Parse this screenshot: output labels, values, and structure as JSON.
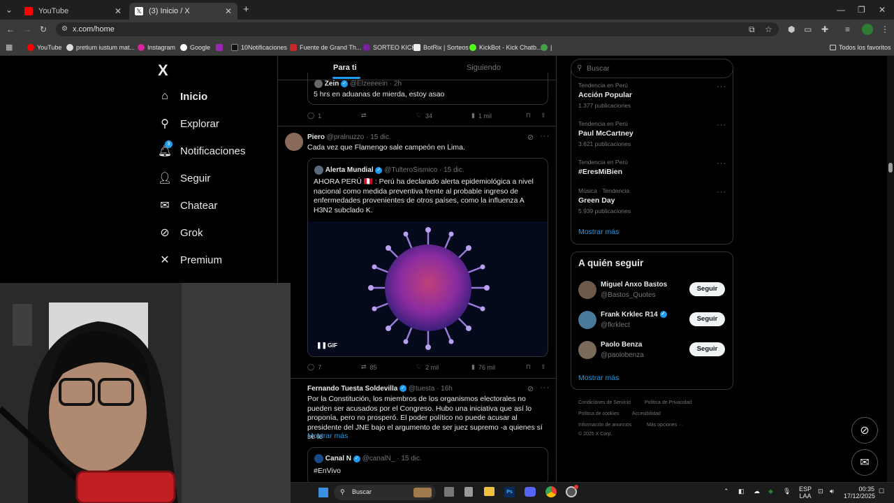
{
  "browser": {
    "tabs": [
      {
        "title": "YouTube",
        "active": false
      },
      {
        "title": "(3) Inicio / X",
        "active": true
      }
    ],
    "url": "x.com/home",
    "bookmarks": [
      "YouTube",
      "pretium iustum mat...",
      "Instagram",
      "Google",
      "10Notificaciones",
      "Fuente de Grand Th...",
      "SORTEO KICK",
      "BotRix | Sorteos",
      "KickBot - Kick Chatb..."
    ],
    "all_bookmarks": "Todos los favoritos"
  },
  "nav": {
    "logo": "X",
    "items": [
      {
        "label": "Inicio",
        "icon": "home-icon"
      },
      {
        "label": "Explorar",
        "icon": "search-icon"
      },
      {
        "label": "Notificaciones",
        "icon": "bell-icon",
        "badge": "3"
      },
      {
        "label": "Seguir",
        "icon": "person-plus-icon"
      },
      {
        "label": "Chatear",
        "icon": "mail-icon"
      },
      {
        "label": "Grok",
        "icon": "grok-icon"
      },
      {
        "label": "Premium",
        "icon": "x-icon"
      }
    ]
  },
  "feed": {
    "tabs": [
      "Para ti",
      "Siguiendo"
    ],
    "tweet0": {
      "author": "Zein",
      "handle": "@Elzeeeein",
      "time": "2h",
      "text": "5 hrs en aduanas de mierda, estoy asao",
      "stats": {
        "replies": "1",
        "retweets": "",
        "likes": "34",
        "views": "1 mil"
      }
    },
    "tweet1": {
      "author": "Piero",
      "handle": "@pralnuzzo",
      "time": "15 dic.",
      "text": "Cada vez que Flamengo sale campeón en Lima.",
      "quote": {
        "author": "Alerta Mundial",
        "handle": "@TulteroSismico",
        "time": "15 dic.",
        "text": "AHORA PERÚ 🇵🇪 : Perú ha declarado alerta epidemiológica a nivel nacional como medida preventiva frente al probable ingreso de enfermedades provenientes de otros países, como la influenza A H3N2 subclado K.",
        "media_badge": "GIF"
      },
      "stats": {
        "replies": "7",
        "retweets": "85",
        "likes": "2 mil",
        "views": "76 mil"
      }
    },
    "tweet2": {
      "author": "Fernando Tuesta Soldevilla",
      "handle": "@tuesta",
      "time": "16h",
      "text": "Por la Constitución, los miembros de los organismos electorales no pueden ser acusados por el Congreso. Hubo una iniciativa que así lo proponía, pero no prosperó. El poder político no puede acusar al presidente del JNE bajo el argumento de ser juez supremo -a quienes sí se le",
      "show_more": "Mostrar más",
      "quote": {
        "author": "Canal N",
        "handle": "@canalN_",
        "time": "15 dic.",
        "text": "#EnVivo"
      }
    }
  },
  "sidebar": {
    "search_placeholder": "Buscar",
    "trends": [
      {
        "meta": "Tendencia en Perú",
        "name": "Acción Popular",
        "count": "1.377 publicaciones"
      },
      {
        "meta": "Tendencia en Perú",
        "name": "Paul McCartney",
        "count": "3.621 publicaciones"
      },
      {
        "meta": "Tendencia en Perú",
        "name": "#EresMiBien",
        "count": ""
      },
      {
        "meta": "Música · Tendencia",
        "name": "Green Day",
        "count": "5.939 publicaciones"
      }
    ],
    "show_more": "Mostrar más",
    "who_to_follow": {
      "title": "A quién seguir",
      "users": [
        {
          "name": "Miguel Anxo Bastos",
          "handle": "@Bastos_Quotes",
          "verified": false
        },
        {
          "name": "Frank Krklec R14",
          "handle": "@fkrklect",
          "verified": true
        },
        {
          "name": "Paolo Benza",
          "handle": "@paolobenza",
          "verified": false
        }
      ],
      "follow_label": "Seguir",
      "show_more": "Mostrar más"
    },
    "footer": [
      "Condiciones de Servicio",
      "Política de Privacidad",
      "Política de cookies",
      "Accesibilidad",
      "Información de anuncios",
      "Más opciones ···",
      "© 2025 X Corp."
    ]
  },
  "taskbar": {
    "search": "Buscar",
    "lang": "ESP",
    "lang2": "LAA",
    "time": "00:35",
    "date": "17/12/2025"
  },
  "colors": {
    "accent": "#1d9bf0",
    "bg": "#000000",
    "border": "#2f3336",
    "muted": "#71767b"
  }
}
